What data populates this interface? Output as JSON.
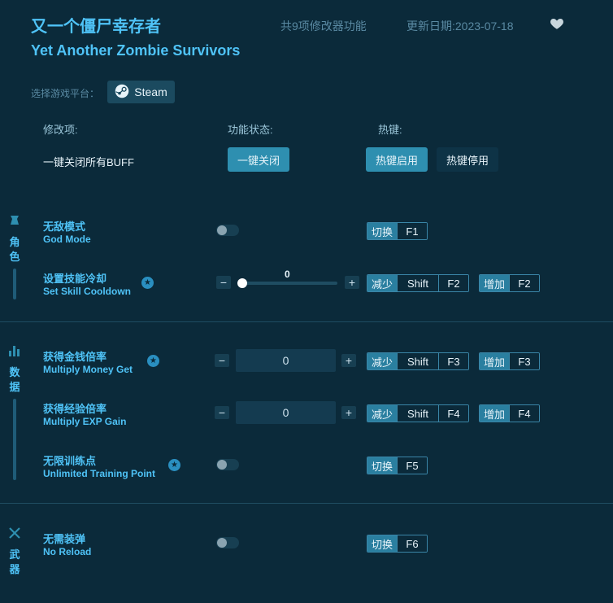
{
  "header": {
    "title_cn": "又一个僵尸幸存者",
    "title_en": "Yet Another Zombie Survivors",
    "feature_count": "共9项修改器功能",
    "update_date": "更新日期:2023-07-18"
  },
  "platform": {
    "label": "选择游戏平台：",
    "steam": "Steam"
  },
  "columns": {
    "mod": "修改项:",
    "status": "功能状态:",
    "hotkey": "热键:"
  },
  "global": {
    "label": "一键关闭所有BUFF",
    "close_all": "一键关闭",
    "hotkey_on": "热键启用",
    "hotkey_off": "热键停用"
  },
  "sections": {
    "role": "角色",
    "data": "数据",
    "weapon": "武器"
  },
  "rows": {
    "god": {
      "cn": "无敌模式",
      "en": "God Mode",
      "action": "切换",
      "key": "F1"
    },
    "skill": {
      "cn": "设置技能冷却",
      "en": "Set Skill Cooldown",
      "value": "0",
      "dec_action": "减少",
      "dec_mod": "Shift",
      "dec_key": "F2",
      "inc_action": "增加",
      "inc_key": "F2"
    },
    "money": {
      "cn": "获得金钱倍率",
      "en": "Multiply Money Get",
      "value": "0",
      "dec_action": "减少",
      "dec_mod": "Shift",
      "dec_key": "F3",
      "inc_action": "增加",
      "inc_key": "F3"
    },
    "exp": {
      "cn": "获得经验倍率",
      "en": "Multiply EXP Gain",
      "value": "0",
      "dec_action": "减少",
      "dec_mod": "Shift",
      "dec_key": "F4",
      "inc_action": "增加",
      "inc_key": "F4"
    },
    "training": {
      "cn": "无限训练点",
      "en": "Unlimited Training Point",
      "action": "切换",
      "key": "F5"
    },
    "reload": {
      "cn": "无需装弹",
      "en": "No Reload",
      "action": "切换",
      "key": "F6"
    }
  },
  "symbols": {
    "minus": "−",
    "plus": "+",
    "star": "★"
  },
  "colors": {
    "accent": "#4fc3f7",
    "background": "#0b2a3a",
    "button": "#2e8fb0"
  },
  "icons": [
    "heart-icon",
    "steam-icon",
    "role-icon",
    "data-icon",
    "weapon-icon",
    "star-icon"
  ]
}
